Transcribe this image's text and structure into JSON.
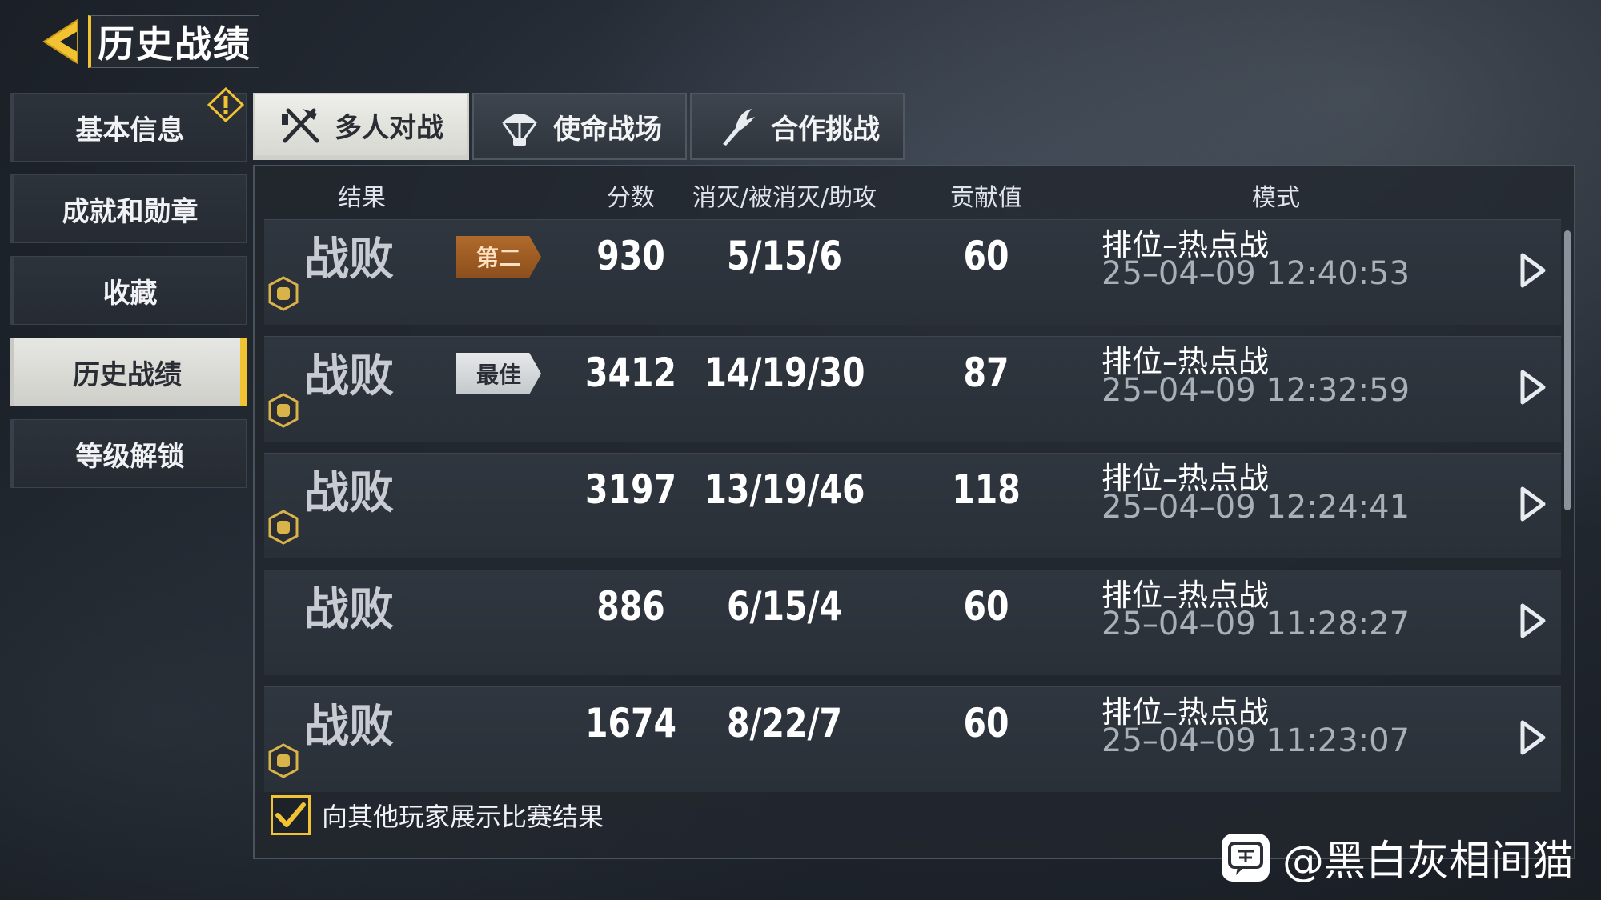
{
  "header": {
    "title": "历史战绩"
  },
  "sidebar": {
    "items": [
      {
        "label": "基本信息"
      },
      {
        "label": "成就和勋章"
      },
      {
        "label": "收藏"
      },
      {
        "label": "历史战绩"
      },
      {
        "label": "等级解锁"
      }
    ],
    "active_index": 3
  },
  "tabs": [
    {
      "label": "多人对战",
      "icon": "crossed-weapons-icon"
    },
    {
      "label": "使命战场",
      "icon": "parachute-icon"
    },
    {
      "label": "合作挑战",
      "icon": "claw-icon"
    }
  ],
  "table": {
    "headers": {
      "result": "结果",
      "score": "分数",
      "kda": "消灭/被消灭/助攻",
      "contribution": "贡献值",
      "mode": "模式"
    },
    "rows": [
      {
        "result": "战败",
        "badge": "第二",
        "badge_style": "bronze",
        "score": "930",
        "kda": "5/15/6",
        "contribution": "60",
        "mode": "排位–热点战",
        "time": "25–04–09 12:40:53",
        "medal": true
      },
      {
        "result": "战败",
        "badge": "最佳",
        "badge_style": "silver",
        "score": "3412",
        "kda": "14/19/30",
        "contribution": "87",
        "mode": "排位–热点战",
        "time": "25–04–09 12:32:59",
        "medal": true
      },
      {
        "result": "战败",
        "badge": "",
        "badge_style": "",
        "score": "3197",
        "kda": "13/19/46",
        "contribution": "118",
        "mode": "排位–热点战",
        "time": "25–04–09 12:24:41",
        "medal": true
      },
      {
        "result": "战败",
        "badge": "",
        "badge_style": "",
        "score": "886",
        "kda": "6/15/4",
        "contribution": "60",
        "mode": "排位–热点战",
        "time": "25–04–09 11:28:27",
        "medal": false
      },
      {
        "result": "战败",
        "badge": "",
        "badge_style": "",
        "score": "1674",
        "kda": "8/22/7",
        "contribution": "60",
        "mode": "排位–热点战",
        "time": "25–04–09 11:23:07",
        "medal": true
      }
    ]
  },
  "footer": {
    "show_results_label": "向其他玩家展示比赛结果",
    "show_results_checked": true
  },
  "watermark": {
    "text": "@黑白灰相间猫",
    "icon": "tieba-icon"
  },
  "colors": {
    "accent": "#f1c232",
    "bronze": "#a0602a"
  }
}
